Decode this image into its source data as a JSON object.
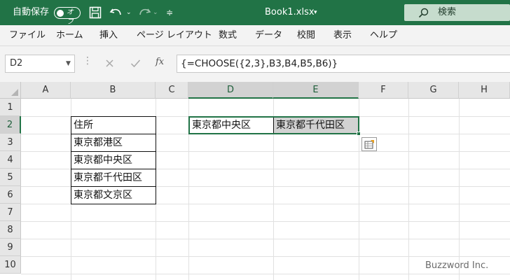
{
  "titlebar": {
    "autosave_label": "自動保存",
    "autosave_state": "オフ",
    "filename": "Book1.xlsx",
    "search_label": "検索"
  },
  "menu": {
    "items": [
      "ファイル",
      "ホーム",
      "挿入",
      "ページ レイアウト",
      "数式",
      "データ",
      "校閲",
      "表示",
      "ヘルプ"
    ]
  },
  "formula_bar": {
    "name_box": "D2",
    "formula": "{=CHOOSE({2,3},B3,B4,B5,B6)}"
  },
  "columns": [
    "A",
    "B",
    "C",
    "D",
    "E",
    "F",
    "G",
    "H"
  ],
  "rows": [
    "1",
    "2",
    "3",
    "4",
    "5",
    "6",
    "7",
    "8",
    "9",
    "10"
  ],
  "cells": {
    "B2": "住所",
    "B3": "東京都港区",
    "B4": "東京都中央区",
    "B5": "東京都千代田区",
    "B6": "東京都文京区",
    "D2": "東京都中央区",
    "E2": "東京都千代田区"
  },
  "watermark": "Buzzword Inc.",
  "colors": {
    "accent": "#217346",
    "ribbon": "#f3f3f3",
    "header": "#e6e6e6"
  }
}
